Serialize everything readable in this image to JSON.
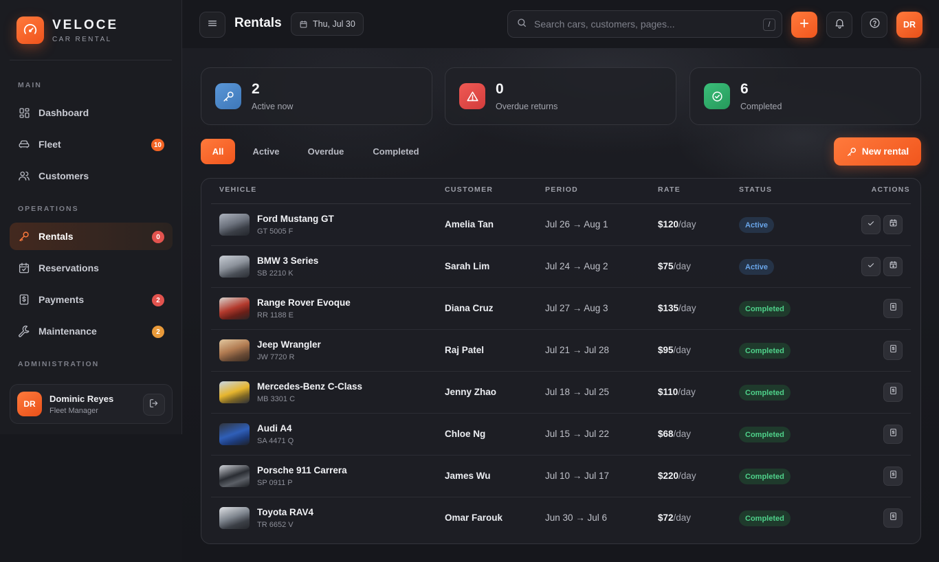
{
  "brand": {
    "name": "VELOCE",
    "subtitle": "CAR RENTAL"
  },
  "sidebar": {
    "sections": {
      "main": "MAIN",
      "operations": "OPERATIONS",
      "administration": "ADMINISTRATION"
    },
    "items": [
      {
        "label": "Dashboard",
        "icon": "grid-icon"
      },
      {
        "label": "Fleet",
        "icon": "car-icon",
        "badge": "10"
      },
      {
        "label": "Customers",
        "icon": "users-icon"
      },
      {
        "label": "Rentals",
        "icon": "key-icon",
        "badge": "0",
        "active": true
      },
      {
        "label": "Reservations",
        "icon": "calendar-check-icon"
      },
      {
        "label": "Payments",
        "icon": "receipt-icon",
        "badge": "2"
      },
      {
        "label": "Maintenance",
        "icon": "wrench-icon",
        "badge": "2"
      }
    ],
    "user": {
      "initials": "DR",
      "name": "Dominic Reyes",
      "role": "Fleet Manager"
    }
  },
  "header": {
    "title": "Rentals",
    "date": "Thu, Jul 30",
    "search_placeholder": "Search cars, customers, pages...",
    "search_shortcut": "/",
    "avatar_initials": "DR"
  },
  "stats": [
    {
      "value": "2",
      "label": "Active now"
    },
    {
      "value": "0",
      "label": "Overdue returns"
    },
    {
      "value": "6",
      "label": "Completed"
    }
  ],
  "filters": [
    "All",
    "Active",
    "Overdue",
    "Completed"
  ],
  "new_rental_label": "New rental",
  "table": {
    "columns": [
      "VEHICLE",
      "CUSTOMER",
      "PERIOD",
      "RATE",
      "STATUS",
      "ACTIONS"
    ],
    "rate_suffix": "/day",
    "rows": [
      {
        "vehicle": "Ford Mustang GT",
        "plate": "GT 5005 F",
        "customer": "Amelia Tan",
        "period": "Jul 26 → Aug 1",
        "rate": "$120",
        "status": "Active"
      },
      {
        "vehicle": "BMW 3 Series",
        "plate": "SB 2210 K",
        "customer": "Sarah Lim",
        "period": "Jul 24 → Aug 2",
        "rate": "$75",
        "status": "Active"
      },
      {
        "vehicle": "Range Rover Evoque",
        "plate": "RR 1188 E",
        "customer": "Diana Cruz",
        "period": "Jul 27 → Aug 3",
        "rate": "$135",
        "status": "Completed"
      },
      {
        "vehicle": "Jeep Wrangler",
        "plate": "JW 7720 R",
        "customer": "Raj Patel",
        "period": "Jul 21 → Jul 28",
        "rate": "$95",
        "status": "Completed"
      },
      {
        "vehicle": "Mercedes-Benz C-Class",
        "plate": "MB 3301 C",
        "customer": "Jenny Zhao",
        "period": "Jul 18 → Jul 25",
        "rate": "$110",
        "status": "Completed"
      },
      {
        "vehicle": "Audi A4",
        "plate": "SA 4471 Q",
        "customer": "Chloe Ng",
        "period": "Jul 15 → Jul 22",
        "rate": "$68",
        "status": "Completed"
      },
      {
        "vehicle": "Porsche 911 Carrera",
        "plate": "SP 0911 P",
        "customer": "James Wu",
        "period": "Jul 10 → Jul 17",
        "rate": "$220",
        "status": "Completed"
      },
      {
        "vehicle": "Toyota RAV4",
        "plate": "TR 6652 V",
        "customer": "Omar Farouk",
        "period": "Jun 30 → Jul 6",
        "rate": "$72",
        "status": "Completed"
      }
    ]
  },
  "colors": {
    "accent": "#f46424",
    "active_badge": "#6aa6ea",
    "completed_badge": "#4fd18a",
    "stat_blue": "#4a86c8",
    "stat_red": "#e04848",
    "stat_green": "#2fae6a"
  }
}
